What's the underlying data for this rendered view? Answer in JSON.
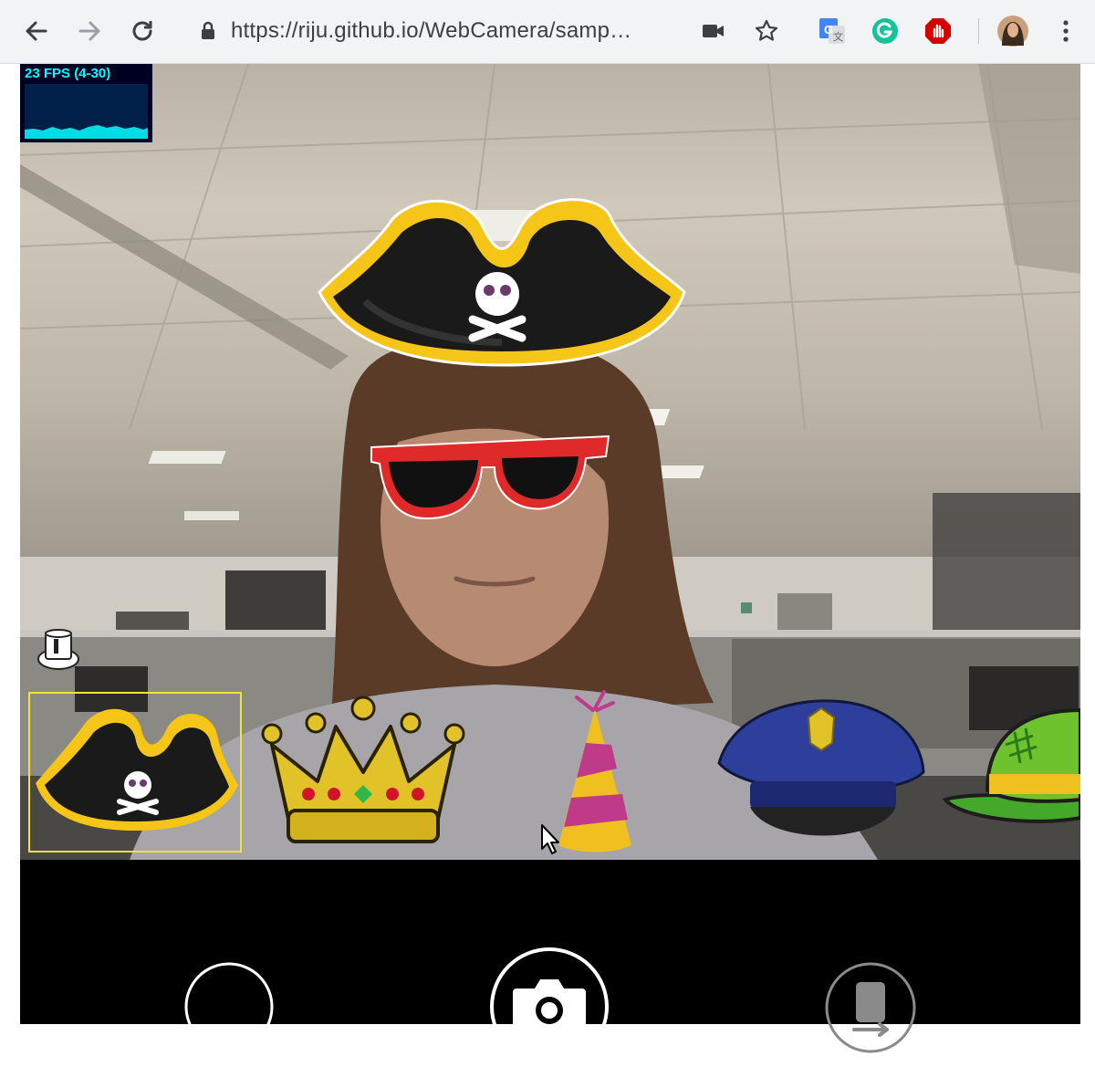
{
  "browser": {
    "url": "https://riju.github.io/WebCamera/samp…",
    "nav_icons": [
      "back-arrow-icon",
      "forward-arrow-icon",
      "reload-icon"
    ],
    "addressbar_icons": [
      "lock-icon",
      "camera-indicator-icon",
      "bookmark-star-icon"
    ],
    "extensions": [
      "google-translate-icon",
      "grammarly-icon",
      "adblock-icon"
    ],
    "menu_icon": "kebab-menu-icon"
  },
  "stats": {
    "fps_label": "23 FPS (4-30)"
  },
  "video": {
    "overlays": [
      "pirate-hat",
      "red-sunglasses"
    ],
    "person": "woman-in-office"
  },
  "hat_carousel": {
    "selected": "pirate-hat",
    "items": [
      {
        "name": "pirate-hat",
        "selected": true
      },
      {
        "name": "crown",
        "selected": false
      },
      {
        "name": "party-hat",
        "selected": false
      },
      {
        "name": "police-cap",
        "selected": false
      },
      {
        "name": "green-bowler-hat",
        "selected": false
      }
    ]
  },
  "controls": {
    "left_button": "filter-toggle-button",
    "center_button": "camera-icon",
    "right_button": "switch-camera-icon"
  },
  "colors": {
    "fps_text": "#00ffff",
    "fps_bg": "#000022",
    "selection_frame": "#f2e33a",
    "pirate_gold": "#f5c518",
    "glasses_red": "#e02a2a"
  }
}
